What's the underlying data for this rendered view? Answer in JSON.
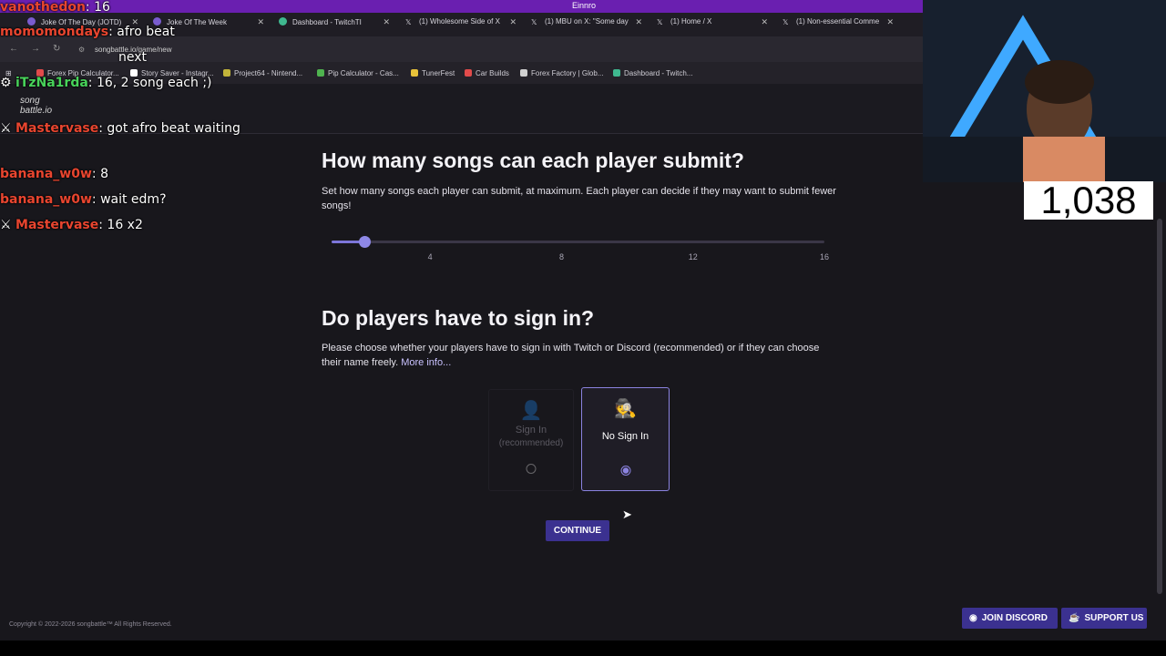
{
  "browser": {
    "window_title": "Einnro",
    "tabs": [
      {
        "label": "Joke Of The Day (JOTD)",
        "color": "#7a5ccf"
      },
      {
        "label": "Joke Of The Week",
        "color": "#7a5ccf"
      },
      {
        "label": "Dashboard - TwitchTI",
        "color": "#3fb88f"
      },
      {
        "label": "(1) Wholesome Side of X",
        "color": "#ffffff"
      },
      {
        "label": "(1) MBU on X: \"Some day",
        "color": "#ffffff"
      },
      {
        "label": "(1) Home / X",
        "color": "#ffffff"
      },
      {
        "label": "(1) Non-essential Comme",
        "color": "#ffffff"
      }
    ],
    "url": "songbattle.io/game/new",
    "bookmarks": [
      {
        "label": "Forex Pip Calculator...",
        "color": "#e24b4b"
      },
      {
        "label": "Story Saver - Instagr...",
        "color": "#ffffff"
      },
      {
        "label": "Project64 - Nintend...",
        "color": "#c2b43a"
      },
      {
        "label": "Pip Calculator - Cas...",
        "color": "#4fb34f"
      },
      {
        "label": "TunerFest",
        "color": "#e8c23a"
      },
      {
        "label": "Car Builds",
        "color": "#e24b4b"
      },
      {
        "label": "Forex Factory | Glob...",
        "color": "#d0d0d0"
      },
      {
        "label": "Dashboard - Twitch...",
        "color": "#3fb88f"
      }
    ]
  },
  "site": {
    "logo_line1": "song",
    "logo_line2": "battle.io"
  },
  "section_songs": {
    "title": "How many songs can each player submit?",
    "description": "Set how many songs each player can submit, at maximum. Each player can decide if they may want to submit fewer songs!",
    "slider": {
      "min": 1,
      "max": 16,
      "value": 2,
      "ticks": [
        "4",
        "8",
        "12",
        "16"
      ]
    }
  },
  "section_signin": {
    "title": "Do players have to sign in?",
    "description": "Please choose whether your players have to sign in with Twitch or Discord (recommended) or if they can choose their name freely.",
    "more_info": "More info...",
    "options": [
      {
        "label": "Sign In",
        "sublabel": "(recommended)",
        "selected": false
      },
      {
        "label": "No Sign In",
        "selected": true
      }
    ]
  },
  "continue_label": "CONTINUE",
  "footer": "Copyright © 2022-2026 songbattle™ All Rights Reserved.",
  "join_discord": "JOIN DISCORD",
  "support_us": "SUPPORT US",
  "stream": {
    "counter": "1,038",
    "chat": [
      {
        "user": "vanothedon",
        "user_color": "#e8452f",
        "text": "16"
      },
      {
        "user": "momomondays",
        "user_color": "#e8452f",
        "text": "afro beat"
      },
      {
        "user": "",
        "user_color": "#e8452f",
        "text": "next"
      },
      {
        "user": "iTzNa1rda",
        "user_color": "#48d35a",
        "text": "16, 2 song each ;)"
      },
      {
        "user": "Mastervase",
        "user_color": "#e8452f",
        "text": "got afro beat waiting"
      },
      {
        "user": "banana_w0w",
        "user_color": "#e8452f",
        "text": "8"
      },
      {
        "user": "banana_w0w",
        "user_color": "#e8452f",
        "text": "wait edm?"
      },
      {
        "user": "Mastervase",
        "user_color": "#e8452f",
        "text": "16 x2"
      }
    ]
  },
  "accent": "#3b3190"
}
